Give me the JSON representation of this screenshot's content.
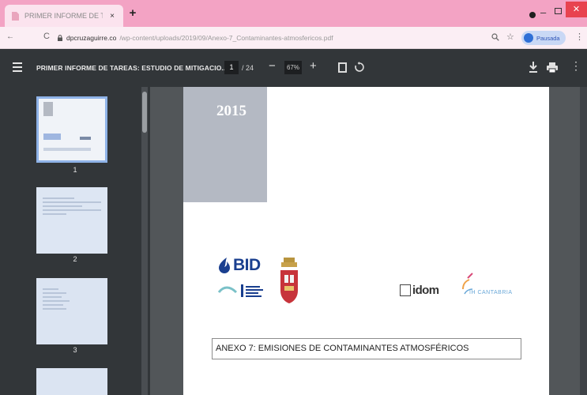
{
  "browser": {
    "tab": {
      "title": "PRIMER INFORME DE TAREAS",
      "close": "×"
    },
    "new_tab": "+",
    "window": {
      "minimize": "–",
      "close": "✕"
    },
    "address": {
      "back": "←",
      "reload": "C",
      "host": "dpcruzaguirre.co",
      "path": "/wp-content/uploads/2019/09/Anexo-7_Contaminantes-atmosfericos.pdf",
      "star": "☆",
      "profile_label": "Pausada",
      "menu": "⋮"
    }
  },
  "pdf_toolbar": {
    "title": "PRIMER INFORME DE TAREAS: ESTUDIO DE MITIGACIO...",
    "page_current": "1",
    "page_total": "/ 24",
    "zoom_minus": "−",
    "zoom_value": "67%",
    "zoom_plus": "+",
    "more": "⋮"
  },
  "thumbnails": [
    {
      "label": "1",
      "selected": true
    },
    {
      "label": "2",
      "selected": false
    },
    {
      "label": "3",
      "selected": false
    }
  ],
  "page": {
    "year": "2015",
    "bid_logo_text": "BID",
    "idom_logo_text": "idom",
    "ih_logo_text": "IH CANTABRIA",
    "annex_title": "ANEXO 7: EMISIONES DE CONTAMINANTES ATMOSFÉRICOS"
  },
  "colors": {
    "tabstrip": "#f3a3c4",
    "pdf_toolbar": "#323639",
    "viewer_bg": "#525659",
    "bid_blue": "#1a3f8f",
    "year_block": "#b4b9c3"
  }
}
